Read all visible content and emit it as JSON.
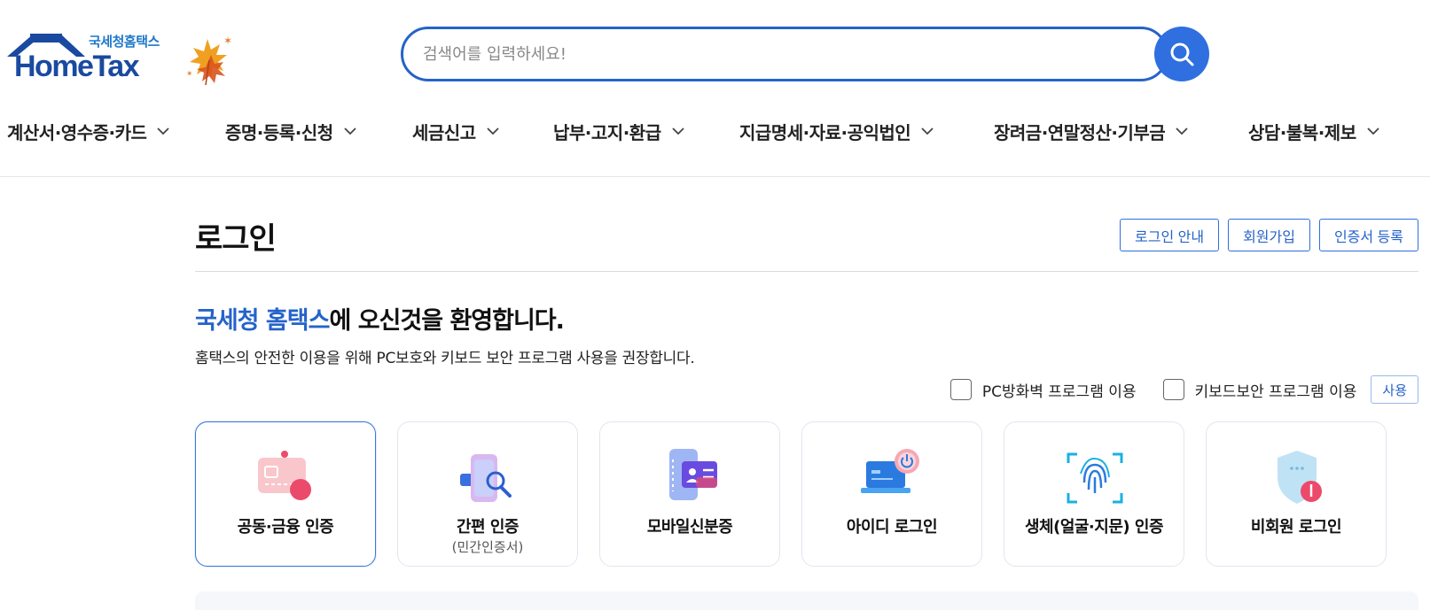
{
  "header": {
    "logo_small": "국세청홈택스",
    "logo_big": "HomeTax",
    "search": {
      "placeholder": "검색어를 입력하세요!"
    }
  },
  "nav": {
    "items": [
      {
        "label": "계산서·영수증·카드"
      },
      {
        "label": "증명·등록·신청"
      },
      {
        "label": "세금신고"
      },
      {
        "label": "납부·고지·환급"
      },
      {
        "label": "지급명세·자료·공익법인"
      },
      {
        "label": "장려금·연말정산·기부금"
      },
      {
        "label": "상담·불복·제보"
      }
    ]
  },
  "main": {
    "title": "로그인",
    "buttons": {
      "login_guide": "로그인 안내",
      "signup": "회원가입",
      "cert_register": "인증서 등록"
    },
    "welcome_accent": "국세청 홈택스",
    "welcome_rest": "에 오신것을 환영합니다.",
    "subtext": "홈택스의 안전한 이용을 위해 PC보호와 키보드 보안 프로그램 사용을 권장합니다.",
    "options": {
      "firewall": "PC방화벽 프로그램 이용",
      "keyboard": "키보드보안 프로그램 이용",
      "use_button": "사용"
    },
    "cards": [
      {
        "label": "공동·금융 인증",
        "sub": "",
        "icon": "certificate-card-icon"
      },
      {
        "label": "간편 인증",
        "sub": "(민간인증서)",
        "icon": "simple-auth-icon"
      },
      {
        "label": "모바일신분증",
        "sub": "",
        "icon": "mobile-id-icon"
      },
      {
        "label": "아이디 로그인",
        "sub": "",
        "icon": "laptop-power-icon"
      },
      {
        "label": "생체(얼굴·지문) 인증",
        "sub": "",
        "icon": "fingerprint-icon"
      },
      {
        "label": "비회원 로그인",
        "sub": "",
        "icon": "shield-icon"
      }
    ]
  },
  "colors": {
    "brand_blue": "#2563c9",
    "search_button": "#2f6fe0",
    "logo_navy": "#1a4aa0"
  }
}
